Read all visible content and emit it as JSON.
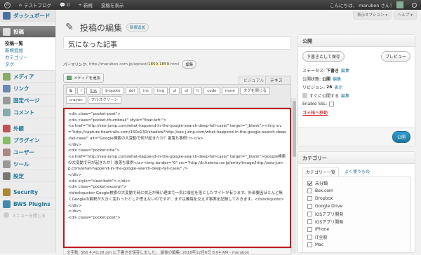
{
  "adminbar": {
    "site_name": "テストブログ",
    "comments_count": "0",
    "new_label": "新規",
    "view_post": "投稿を表示",
    "greeting": "こんにちは、 marubon さん！"
  },
  "sidebar": {
    "dashboard": "ダッシュボード",
    "posts": "投稿",
    "submenu": [
      "投稿一覧",
      "新規追加",
      "カテゴリー",
      "タグ"
    ],
    "items": [
      "メディア",
      "リンク",
      "固定ページ",
      "コメント",
      "外観",
      "プラグイン",
      "ユーザー",
      "ツール",
      "設定",
      "Security",
      "BWS Plugins"
    ],
    "collapse": "メニューを閉じる"
  },
  "screen_options": "表示オプション ▾",
  "help": "ヘルプ ▾",
  "page_title": "投稿の編集",
  "add_new": "新規追加",
  "post_title": "気になった記事",
  "permalink": {
    "label": "パーマリンク:",
    "url_prefix": "http://marubon.com.jp/wptest/",
    "slug": "1850-1859",
    "url_suffix": ".html",
    "edit": "編集"
  },
  "media_button": "メディアを追加",
  "tabs": {
    "visual": "ビジュアル",
    "text": "テキスト"
  },
  "quicktags": [
    "b",
    "i",
    "link",
    "b-quote",
    "del",
    "ins",
    "img",
    "ul",
    "ol",
    "li",
    "code",
    "more",
    "タグを閉じる",
    "crayon",
    "フルスクリーン"
  ],
  "editor_lines": [
    "<div class=\"pocket-post\">",
    "<div class=\"pocket-thumbnail\" style=\"float:left;\">",
    "<a href=\"http://seo-jump.com/what-happend-in-the-google-search-deep-fall-case/\" target=\"_blank\"><img src=\"http://capture.heartrails.com/150x130/shadow?http://seo-jump.com/what-happend-in-the-google-search-deep-fall-case/\" alt=\"Google検索の大変動で何が起きたか？激落ち事例\"/></a>",
    "</div>",
    "<div class=\"pocket-title\">",
    "<a href=\"http://seo-jump.com/what-happend-in-the-google-search-deep-fall-case/\" target=\"_blank\">Google検索の大変動で何が起きたか？激落ち事例</a><img border=\"0\" src=\"http://b.hatena.ne.jp/entry/image/http://seo-jump.com/what-happend-in-the-google-search-deep-fall-case/\" />",
    "</div>",
    "<div style=\"clear:both\"></div>",
    "<div class=\"pocket-excerpt\">",
    "<blockquote>Google検索の大変動で時に貧乏が無い理由で一気に順位を落としたサイトが有ります。外部要因ほとんど無くGoogleの解釈が大きく変わったとしか思えないのですが、まずは推論を交えず事実を記録しておきます。</blockquote>",
    "</div>",
    "</div>",
    "<div class=\"pocket-post\">"
  ],
  "status_bar": "文字数: 560        4:41:28 pm に下書きを保存しました。 最後の編集: 2018年12月6日 8:04 AM - marubon",
  "publish_box": {
    "title": "公開",
    "save_draft": "下書きとして保存",
    "preview": "プレビュー",
    "status_label": "ステータス:",
    "status_value": "下書き",
    "visibility_label": "公開状態:",
    "visibility_value": "公開",
    "revisions_label": "リビジョン:",
    "revisions_value": "26",
    "revisions_link": "表示",
    "schedule_label": "すぐに公開する",
    "edit": "編集",
    "ssl_label": "Enable SSL:",
    "trash": "ゴミ箱へ移動",
    "publish": "公開"
  },
  "categories_box": {
    "title": "カテゴリー",
    "tab_all": "カテゴリー一覧",
    "tab_popular": "よく使うもの",
    "items": [
      {
        "name": "未分類",
        "checked": true
      },
      {
        "name": "Box.com",
        "checked": false
      },
      {
        "name": "Dropbox",
        "checked": false
      },
      {
        "name": "Google Drive",
        "checked": false
      },
      {
        "name": "iOSアプリ開発",
        "checked": false
      },
      {
        "name": "iOSアプリ開発",
        "checked": false
      },
      {
        "name": "iPhone",
        "checked": false
      },
      {
        "name": "IT全般",
        "checked": false
      },
      {
        "name": "Mac",
        "checked": false
      }
    ]
  }
}
